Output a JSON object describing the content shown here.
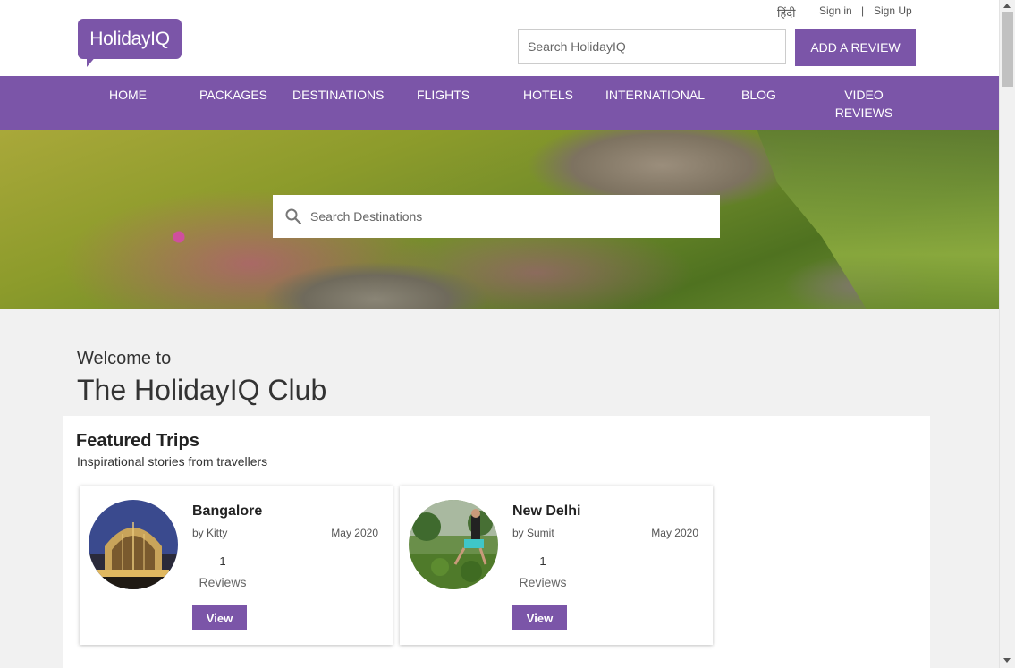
{
  "header": {
    "logo_text": "HolidayIQ",
    "hindi_link": "हिंदी",
    "signin_label": "Sign in",
    "separator": "|",
    "signup_label": "Sign Up",
    "search_placeholder": "Search HolidayIQ",
    "add_review_label": "ADD A REVIEW"
  },
  "nav": {
    "items": [
      {
        "label": "HOME"
      },
      {
        "label": "PACKAGES"
      },
      {
        "label": "DESTINATIONS"
      },
      {
        "label": "FLIGHTS"
      },
      {
        "label": "HOTELS"
      },
      {
        "label": "INTERNATIONAL"
      },
      {
        "label": "BLOG"
      },
      {
        "label": "VIDEO REVIEWS"
      }
    ]
  },
  "hero": {
    "search_placeholder": "Search Destinations",
    "search_icon": "search-icon"
  },
  "welcome": {
    "line1": "Welcome to",
    "line2": "The HolidayIQ Club"
  },
  "featured": {
    "title": "Featured Trips",
    "subtitle": "Inspirational stories from travellers",
    "trips": [
      {
        "name": "Bangalore",
        "by": "by Kitty",
        "date": "May 2020",
        "count": "1",
        "reviews_label": "Reviews",
        "view_label": "View"
      },
      {
        "name": "New Delhi",
        "by": "by Sumit",
        "date": "May 2020",
        "count": "1",
        "reviews_label": "Reviews",
        "view_label": "View"
      }
    ]
  },
  "colors": {
    "brand_purple": "#7b55a8",
    "page_background": "#f1f1f1"
  }
}
